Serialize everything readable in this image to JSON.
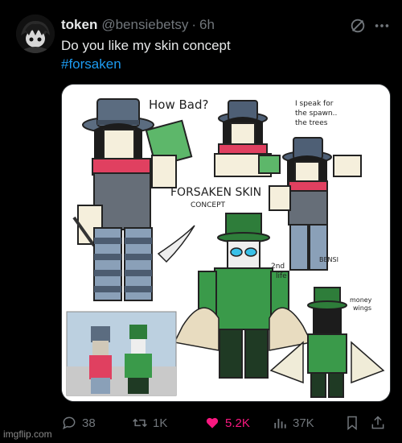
{
  "post": {
    "author_name": "token",
    "author_handle": "@bensiebetsy",
    "separator": "·",
    "time": "6h",
    "text": "Do you like my skin concept",
    "hashtag": "#forsaken"
  },
  "artwork": {
    "label_how_bad": "How Bad?",
    "label_speak": [
      "I speak for",
      "the spawn..",
      "the trees"
    ],
    "label_title": "FORSAKEN SKIN",
    "label_concept": "CONCEPT",
    "label_2nd": [
      "2nd",
      "life"
    ],
    "label_money": [
      "money",
      "wings"
    ],
    "label_bensi": "BENSI"
  },
  "actions": {
    "replies": "38",
    "reposts": "1K",
    "likes": "5.2K",
    "views": "37K"
  },
  "watermark": "imgflip.com",
  "colors": {
    "background": "#000000",
    "link": "#1d9bf0",
    "like": "#f91880",
    "muted": "#71767b"
  }
}
